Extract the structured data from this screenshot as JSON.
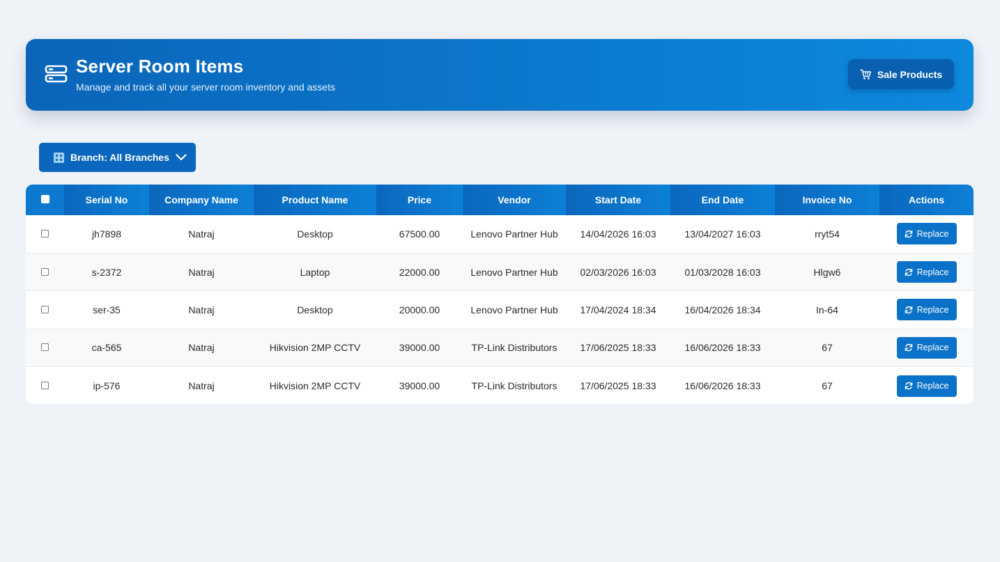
{
  "header": {
    "title": "Server Room Items",
    "subtitle": "Manage and track all your server room inventory and assets",
    "icon": "server-icon",
    "sale_button_label": "Sale Products"
  },
  "filter": {
    "branch_label": "Branch: All Branches"
  },
  "table": {
    "columns": [
      "Serial No",
      "Company Name",
      "Product Name",
      "Price",
      "Vendor",
      "Start Date",
      "End Date",
      "Invoice No",
      "Actions"
    ],
    "action_label": "Replace",
    "rows": [
      {
        "serial": "jh7898",
        "company": "Natraj",
        "product": "Desktop",
        "price": "67500.00",
        "vendor": "Lenovo Partner Hub",
        "start": "14/04/2026 16:03",
        "end": "13/04/2027 16:03",
        "invoice": "rryt54"
      },
      {
        "serial": "s-2372",
        "company": "Natraj",
        "product": "Laptop",
        "price": "22000.00",
        "vendor": "Lenovo Partner Hub",
        "start": "02/03/2026 16:03",
        "end": "01/03/2028 16:03",
        "invoice": "Hlgw6"
      },
      {
        "serial": "ser-35",
        "company": "Natraj",
        "product": "Desktop",
        "price": "20000.00",
        "vendor": "Lenovo Partner Hub",
        "start": "17/04/2024 18:34",
        "end": "16/04/2026 18:34",
        "invoice": "In-64"
      },
      {
        "serial": "ca-565",
        "company": "Natraj",
        "product": "Hikvision 2MP CCTV",
        "price": "39000.00",
        "vendor": "TP-Link Distributors",
        "start": "17/06/2025 18:33",
        "end": "16/06/2026 18:33",
        "invoice": "67"
      },
      {
        "serial": "ip-576",
        "company": "Natraj",
        "product": "Hikvision 2MP CCTV",
        "price": "39000.00",
        "vendor": "TP-Link Distributors",
        "start": "17/06/2025 18:33",
        "end": "16/06/2026 18:33",
        "invoice": "67"
      }
    ]
  }
}
